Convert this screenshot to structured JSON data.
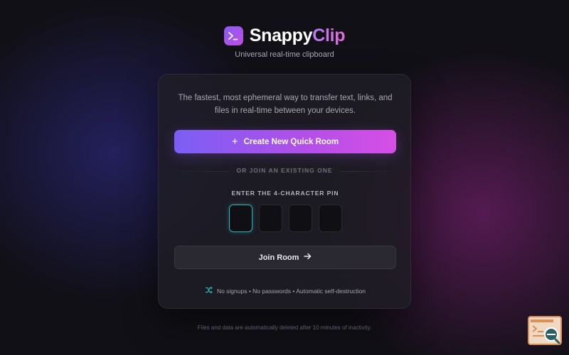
{
  "brand": {
    "name_part1": "Snappy",
    "name_part2": "Clip",
    "tagline": "Universal real-time clipboard"
  },
  "card": {
    "intro": "The fastest, most ephemeral way to transfer text, links, and files in real-time between your devices.",
    "create_button": {
      "icon": "plus-icon",
      "label": "Create New Quick Room"
    },
    "divider_label": "OR JOIN AN EXISTING ONE",
    "pin_label": "ENTER THE 4-CHARACTER PIN",
    "pin_inputs": [
      "",
      "",
      "",
      ""
    ],
    "join_button": {
      "label": "Join Room",
      "icon": "arrow-right-icon"
    },
    "footnote": "No signups • No passwords • Automatic self-destruction"
  },
  "bottom_note": "Files and data are automatically deleted after 10 minutes of inactivity.",
  "colors": {
    "accent_start": "#7b5ff5",
    "accent_end": "#d64fe6",
    "pin_focus": "#2ab3b9",
    "background": "#111016"
  }
}
